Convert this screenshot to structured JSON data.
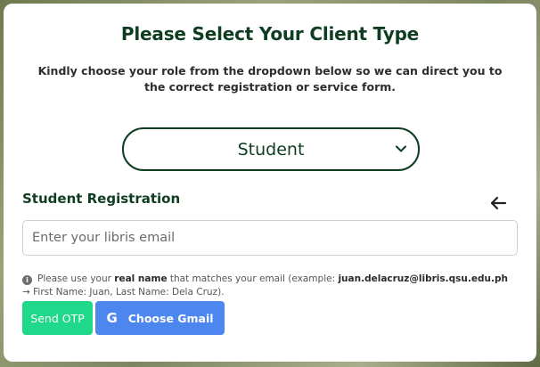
{
  "header": {
    "title": "Please Select Your Client Type",
    "subtitle": "Kindly choose your role from the dropdown below so we can direct you to the correct registration or service form."
  },
  "client_type_select": {
    "selected": "Student"
  },
  "registration": {
    "section_title": "Student Registration",
    "email_placeholder": "Enter your libris email",
    "email_value": "",
    "note": {
      "prefix": "Please use your ",
      "emphasis": "real name",
      "middle": " that matches your email (example: ",
      "example_email": "juan.delacruz@libris.qsu.edu.ph",
      "arrow": " →",
      "suffix": " First Name: Juan, Last Name: Dela Cruz)."
    },
    "send_otp_label": "Send OTP",
    "choose_gmail_label": "Choose Gmail",
    "gmail_icon_glyph": "G"
  },
  "icons": {
    "back": "arrow-left-icon",
    "dropdown": "chevron-down-icon",
    "info": "info-icon"
  },
  "colors": {
    "primary_dark_green": "#0f3d22",
    "send_otp_green": "#1fd889",
    "gmail_blue": "#4e86f0"
  }
}
